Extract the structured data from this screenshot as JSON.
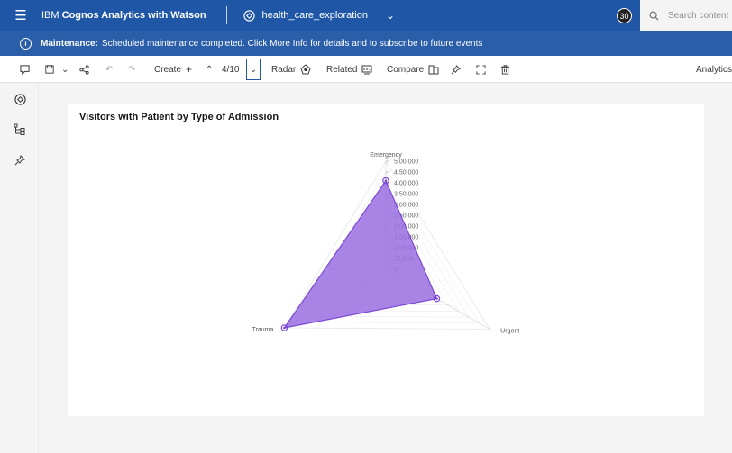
{
  "header": {
    "app_title_prefix": "IBM ",
    "app_title_bold": "Cognos Analytics with Watson",
    "project_name": "health_care_exploration",
    "avatar_text": "30",
    "search_placeholder": "Search content"
  },
  "banner": {
    "label": "Maintenance:",
    "message": "Scheduled maintenance completed. Click More Info for details and to subscribe to future events"
  },
  "toolbar": {
    "create_label": "Create",
    "page_count": "4/10",
    "radar_label": "Radar",
    "related_label": "Related",
    "compare_label": "Compare",
    "analytics_label": "Analytics"
  },
  "colors": {
    "topbar": "#1f57a6",
    "banner": "#2a5ea9",
    "radar_fill": "#9b6fe0",
    "radar_stroke": "#7b48d6"
  },
  "chart_data": {
    "type": "radar",
    "title": "Visitors with Patient by Type of Admission",
    "categories": [
      "Emergency",
      "Urgent",
      "Trauma"
    ],
    "series": [
      {
        "values": [
          410000,
          245000,
          500000
        ]
      }
    ],
    "ylim": [
      0,
      500000
    ],
    "ticks": [
      "0",
      "50,000",
      "1,00,000",
      "1,50,000",
      "2,00,000",
      "2,50,000",
      "3,00,000",
      "3,50,000",
      "4,00,000",
      "4,50,000",
      "5,00,000"
    ]
  }
}
